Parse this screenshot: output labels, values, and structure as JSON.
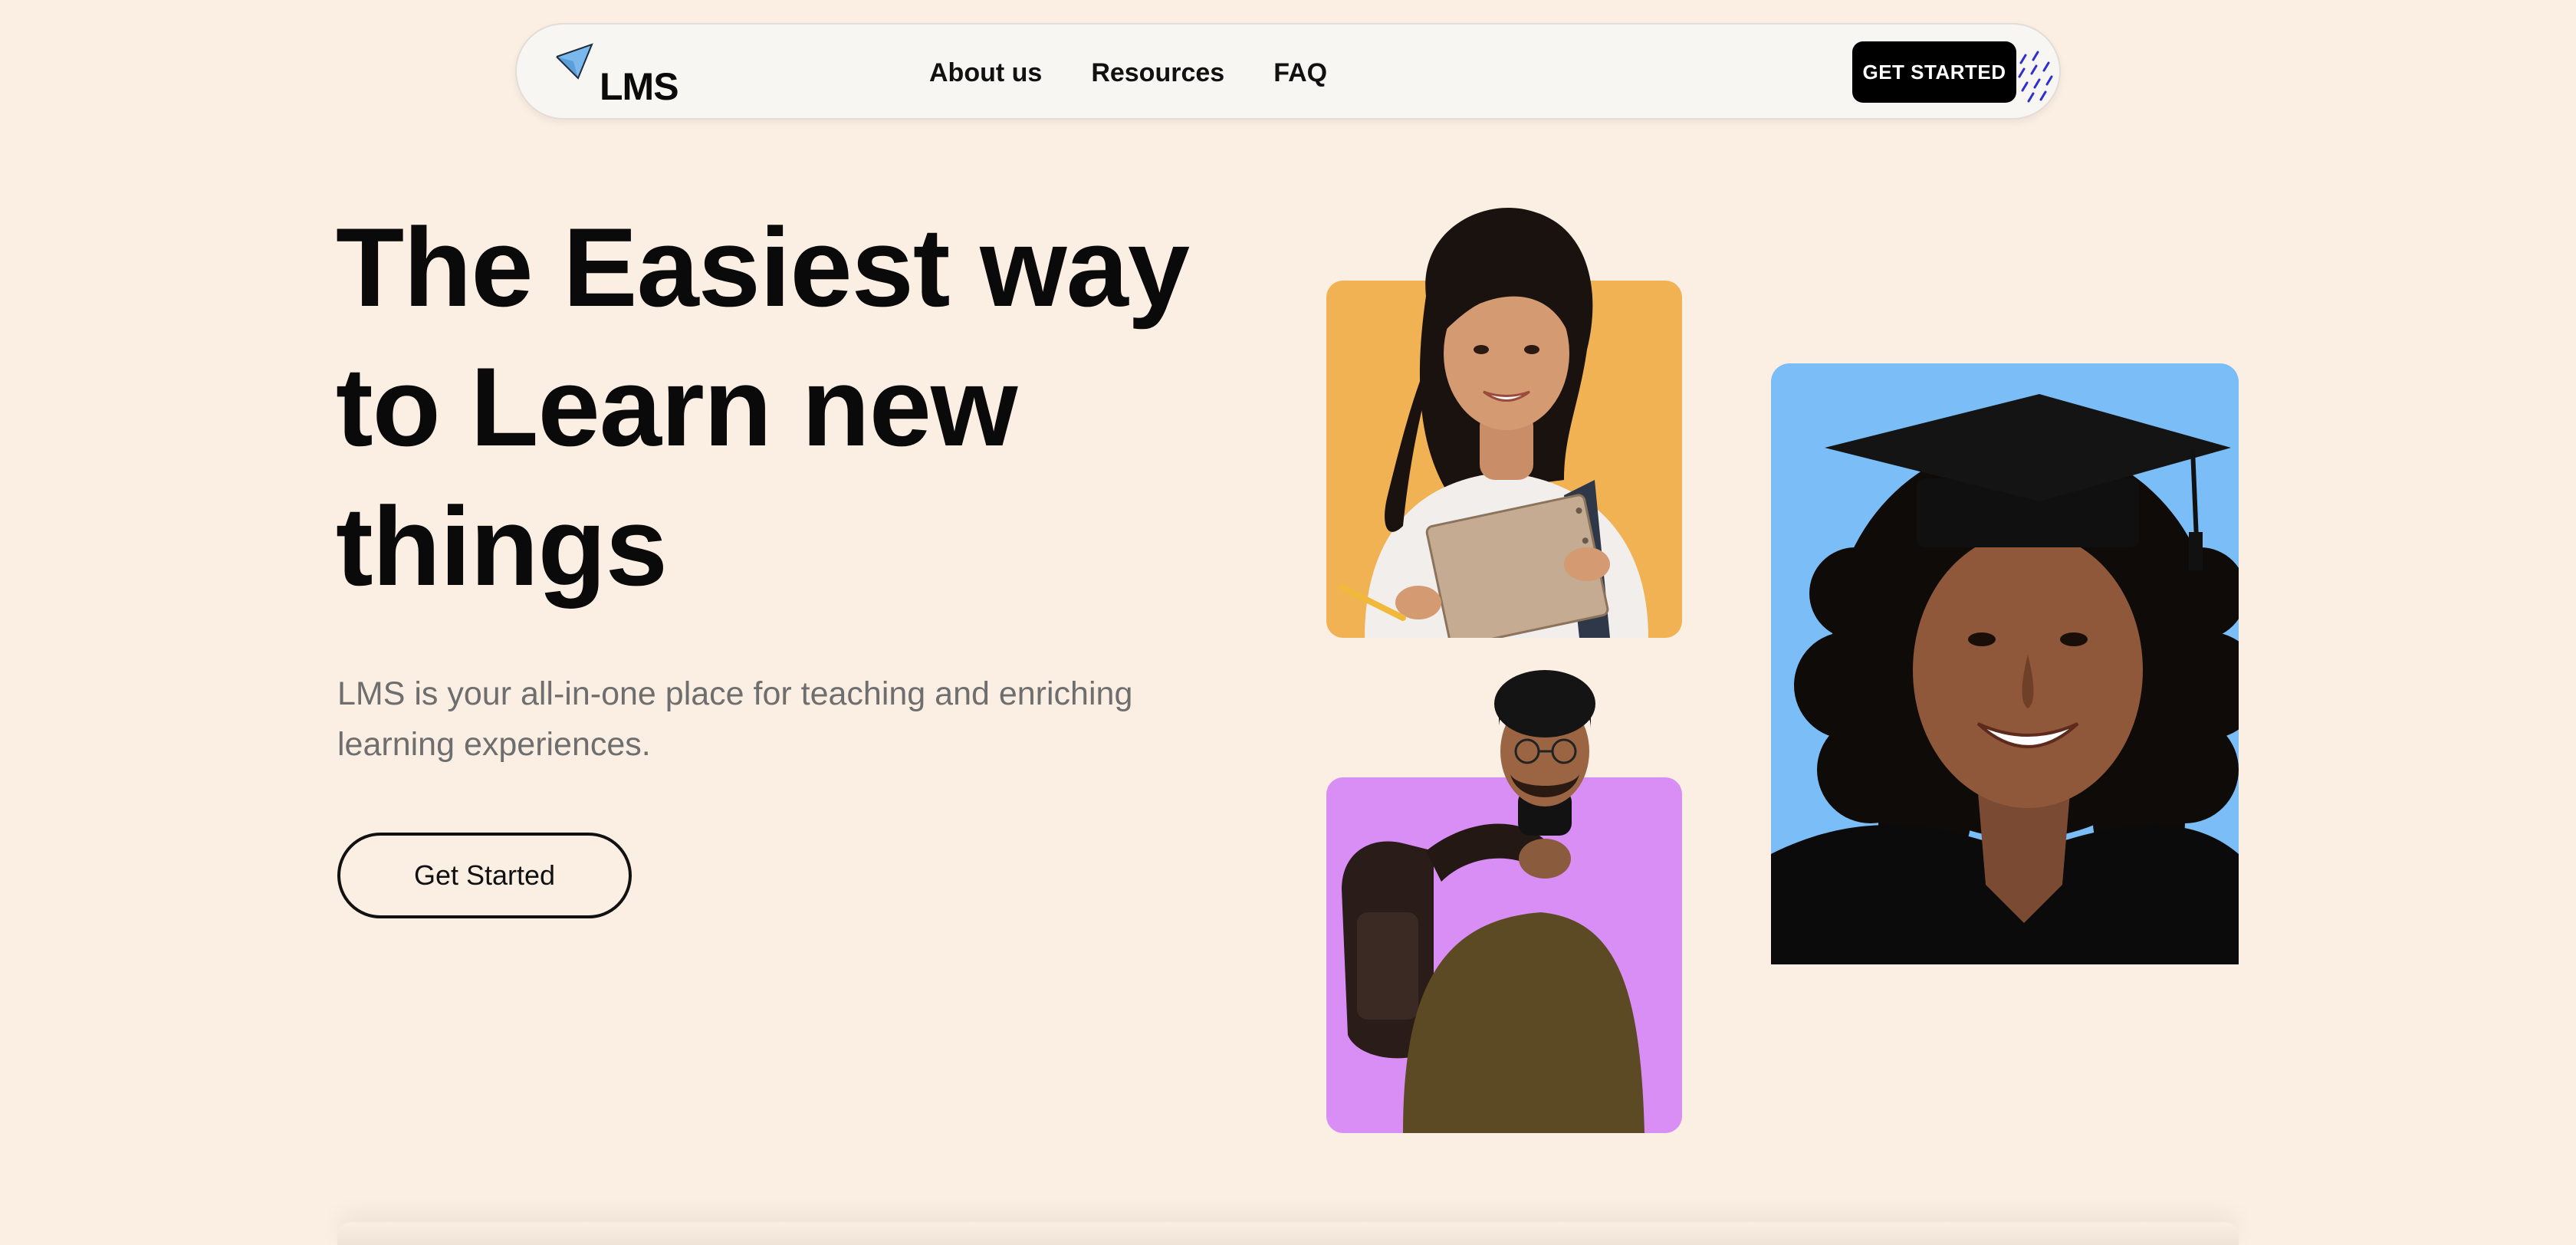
{
  "nav": {
    "logo_text": "LMS",
    "links": [
      "About us",
      "Resources",
      "FAQ"
    ],
    "cta_label": "GET STARTED"
  },
  "hero": {
    "line1": "The Easiest way",
    "line2_pre": "to ",
    "line2_highlight": "Learn",
    "line2_post": " new",
    "line3": "things",
    "subtitle": "LMS is your all-in-one place for teaching and enriching learning experiences.",
    "button_label": "Get Started"
  },
  "colors": {
    "background": "#fbefe4",
    "highlight": "#f5d3a2",
    "card_orange": "#f0b252",
    "card_purple": "#d88ef4",
    "card_blue": "#7bbdf7"
  },
  "images": [
    {
      "name": "student-with-notebook-photo",
      "card": "orange"
    },
    {
      "name": "student-with-backpack-photo",
      "card": "purple"
    },
    {
      "name": "graduate-photo",
      "card": "blue"
    }
  ]
}
